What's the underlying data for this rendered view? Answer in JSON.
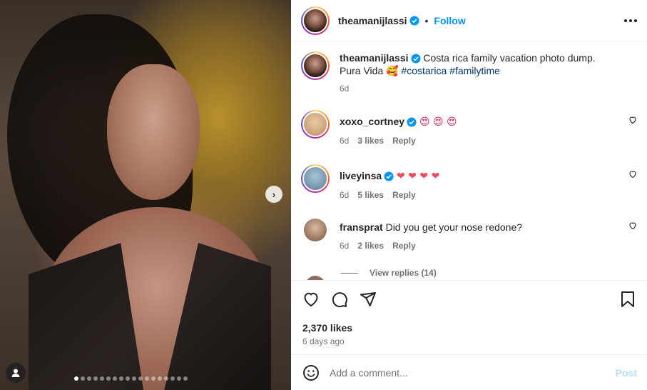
{
  "post": {
    "username": "theamanijlassi",
    "separator": "•",
    "follow_label": "Follow",
    "media_slide_count": 18,
    "media_active_slide": 1
  },
  "caption": {
    "username": "theamanijlassi",
    "text": "Costa rica family vacation photo dump. Pura Vida",
    "emoji": "🥰",
    "hashtags": [
      "#costarica",
      "#familytime"
    ],
    "age": "6d"
  },
  "comments": [
    {
      "username": "xoxo_cortney",
      "verified": true,
      "text": "😍 😍 😍",
      "age": "6d",
      "likes": "3 likes",
      "reply_label": "Reply"
    },
    {
      "username": "liveyinsa",
      "verified": true,
      "text": "❤ ❤ ❤ ❤",
      "age": "6d",
      "likes": "5 likes",
      "reply_label": "Reply"
    },
    {
      "username": "fransprat",
      "verified": false,
      "text": "Did you get your nose redone?",
      "age": "6d",
      "likes": "2 likes",
      "reply_label": "Reply",
      "view_replies": "View replies (14)"
    }
  ],
  "engagement": {
    "likes": "2,370 likes",
    "posted": "6 days ago"
  },
  "add_comment": {
    "placeholder": "Add a comment...",
    "post_label": "Post"
  },
  "icons": {
    "heart": "heart-icon",
    "comment": "comment-icon",
    "share": "share-icon",
    "bookmark": "bookmark-icon",
    "emoji": "emoji-icon",
    "more": "more-options-icon",
    "verified": "verified-badge-icon",
    "next": "chevron-right-icon",
    "user_tag": "user-tag-icon"
  },
  "colors": {
    "accent": "#0095f6",
    "verified": "#0095f6",
    "hashtag": "#00376b",
    "muted": "#737373",
    "post_disabled": "#b2dffc",
    "heart_red": "#ed4956"
  }
}
